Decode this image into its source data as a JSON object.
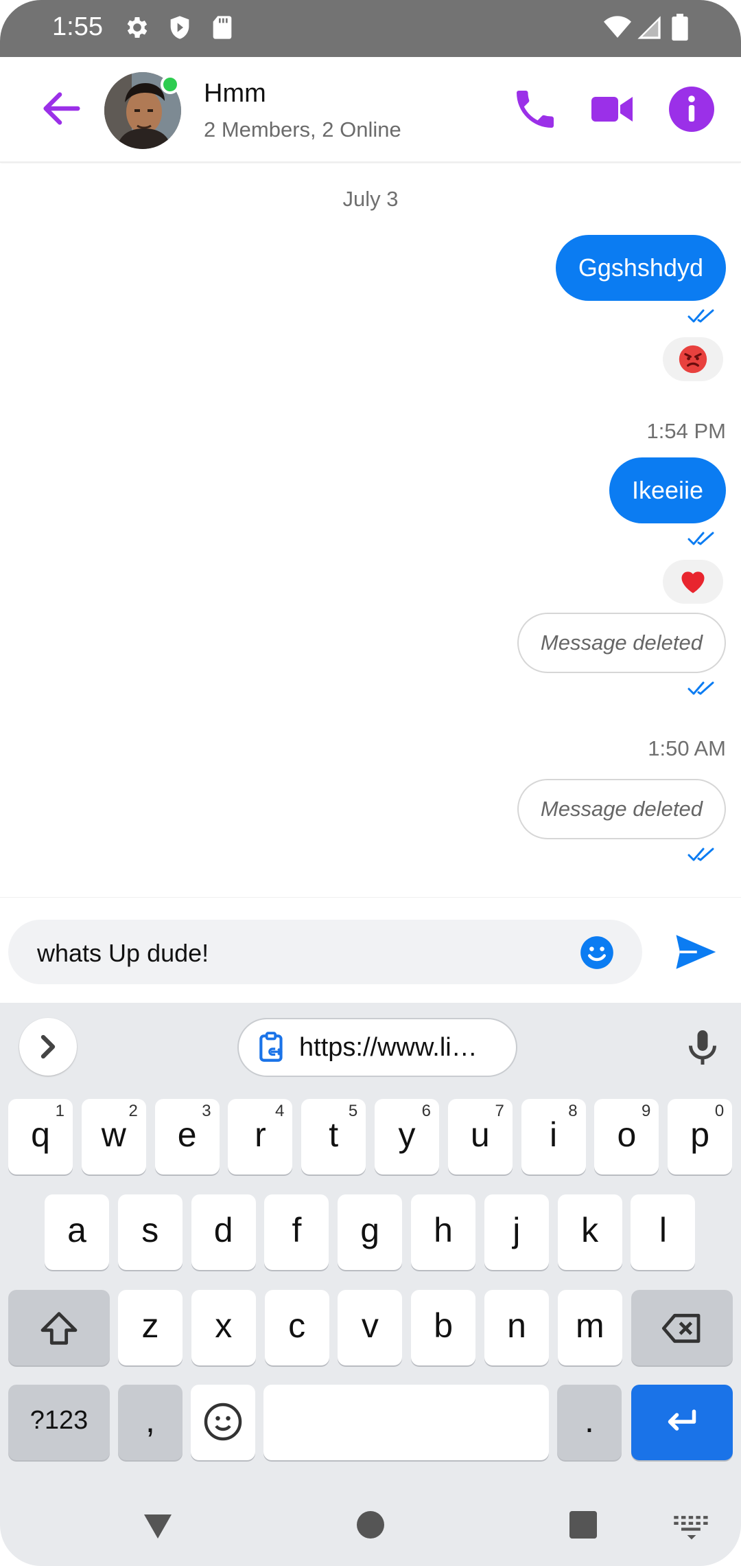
{
  "status_bar": {
    "time": "1:55",
    "left_icons": [
      "settings-icon",
      "shield-icon",
      "sd-card-icon"
    ],
    "right_icons": [
      "wifi-icon",
      "cellular-signal-icon",
      "battery-icon"
    ]
  },
  "header": {
    "title": "Hmm",
    "subtitle": "2 Members, 2 Online",
    "online": true,
    "accent_color": "#9b30e8"
  },
  "messages": {
    "date_separator": "July 3",
    "items": [
      {
        "type": "sent",
        "text": "Ggshshdyd",
        "reaction": "angry-face",
        "status": "read"
      },
      {
        "type": "time",
        "text": "1:54 PM"
      },
      {
        "type": "sent",
        "text": "Ikeeiie",
        "reaction": "red-heart",
        "status": "read"
      },
      {
        "type": "deleted",
        "text": "Message deleted",
        "status": "read"
      },
      {
        "type": "time",
        "text": "1:50 AM"
      },
      {
        "type": "deleted",
        "text": "Message deleted",
        "status": "read"
      }
    ],
    "bubble_color": "#0b7cf2"
  },
  "composer": {
    "value": "whats Up dude!",
    "send_color": "#0b7cf2"
  },
  "keyboard": {
    "clipboard_suggestion": "https://www.li…",
    "row1": [
      {
        "key": "q",
        "hint": "1"
      },
      {
        "key": "w",
        "hint": "2"
      },
      {
        "key": "e",
        "hint": "3"
      },
      {
        "key": "r",
        "hint": "4"
      },
      {
        "key": "t",
        "hint": "5"
      },
      {
        "key": "y",
        "hint": "6"
      },
      {
        "key": "u",
        "hint": "7"
      },
      {
        "key": "i",
        "hint": "8"
      },
      {
        "key": "o",
        "hint": "9"
      },
      {
        "key": "p",
        "hint": "0"
      }
    ],
    "row2": [
      "a",
      "s",
      "d",
      "f",
      "g",
      "h",
      "j",
      "k",
      "l"
    ],
    "row3": [
      "z",
      "x",
      "c",
      "v",
      "b",
      "n",
      "m"
    ],
    "symbols_label": "?123",
    "comma_label": ",",
    "period_label": ".",
    "enter_color": "#1a73e8"
  }
}
